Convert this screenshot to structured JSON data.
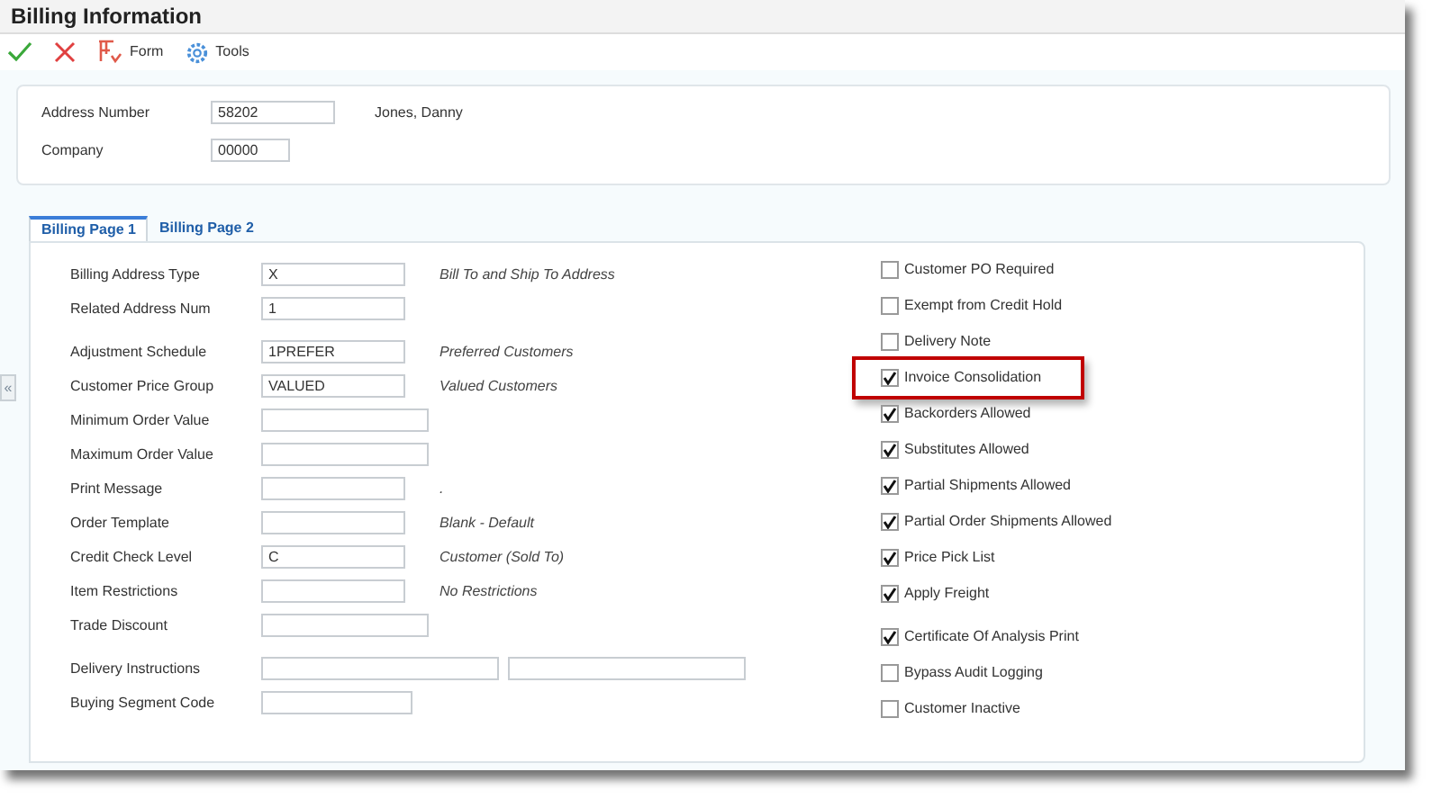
{
  "window": {
    "title": "Billing Information"
  },
  "toolbar": [
    {
      "kind": "ok"
    },
    {
      "kind": "cancel"
    },
    {
      "kind": "form",
      "label": "Form"
    },
    {
      "kind": "tools",
      "label": "Tools"
    }
  ],
  "header": {
    "fields": [
      {
        "label": "Address Number",
        "value": "58202",
        "description": "Jones, Danny"
      },
      {
        "label": "Company",
        "value": "00000"
      }
    ]
  },
  "collapse_handle": "«",
  "tabs": [
    {
      "label": "Billing Page 1",
      "selected": true
    },
    {
      "label": "Billing Page 2",
      "selected": false
    }
  ],
  "fields": [
    {
      "label": "Billing Address Type",
      "value": "X",
      "description": "Bill To and Ship To Address",
      "kind": "short"
    },
    {
      "label": "Related Address Num",
      "value": "1",
      "kind": "short"
    },
    {
      "label": "Adjustment Schedule",
      "value": "1PREFER",
      "description": "Preferred Customers",
      "kind": "short"
    },
    {
      "label": "Customer Price Group",
      "value": "VALUED",
      "description": "Valued Customers",
      "kind": "short"
    },
    {
      "label": "Minimum Order Value",
      "kind": "wide"
    },
    {
      "label": "Maximum Order Value",
      "kind": "wide"
    },
    {
      "label": "Print Message",
      "description": ".",
      "kind": "short"
    },
    {
      "label": "Order Template",
      "description": "Blank - Default",
      "kind": "short"
    },
    {
      "label": "Credit Check Level",
      "value": "C",
      "description": "Customer (Sold To)",
      "kind": "short"
    },
    {
      "label": "Item Restrictions",
      "description": "No Restrictions",
      "kind": "short"
    },
    {
      "label": "Trade Discount",
      "kind": "wide"
    },
    {
      "label": "Delivery Instructions",
      "kind": "double"
    },
    {
      "label": "Buying Segment Code",
      "kind": "medium"
    }
  ],
  "checkboxes": [
    {
      "label": "Customer PO Required",
      "checked": false,
      "highlighted": false
    },
    {
      "label": "Exempt from Credit Hold",
      "checked": false,
      "highlighted": false
    },
    {
      "label": "Delivery Note",
      "checked": false,
      "highlighted": false
    },
    {
      "label": "Invoice Consolidation",
      "checked": true,
      "highlighted": true
    },
    {
      "label": "Backorders Allowed",
      "checked": true,
      "highlighted": false
    },
    {
      "label": "Substitutes Allowed",
      "checked": true,
      "highlighted": false
    },
    {
      "label": "Partial Shipments Allowed",
      "checked": true,
      "highlighted": false
    },
    {
      "label": "Partial Order Shipments Allowed",
      "checked": true,
      "highlighted": false
    },
    {
      "label": "Price Pick List",
      "checked": true,
      "highlighted": false
    },
    {
      "label": "Apply Freight",
      "checked": true,
      "highlighted": false
    },
    {
      "label": "Certificate Of Analysis Print",
      "checked": true,
      "highlighted": false
    },
    {
      "label": "Bypass Audit Logging",
      "checked": false,
      "highlighted": false
    },
    {
      "label": "Customer Inactive",
      "checked": false,
      "highlighted": false
    }
  ]
}
